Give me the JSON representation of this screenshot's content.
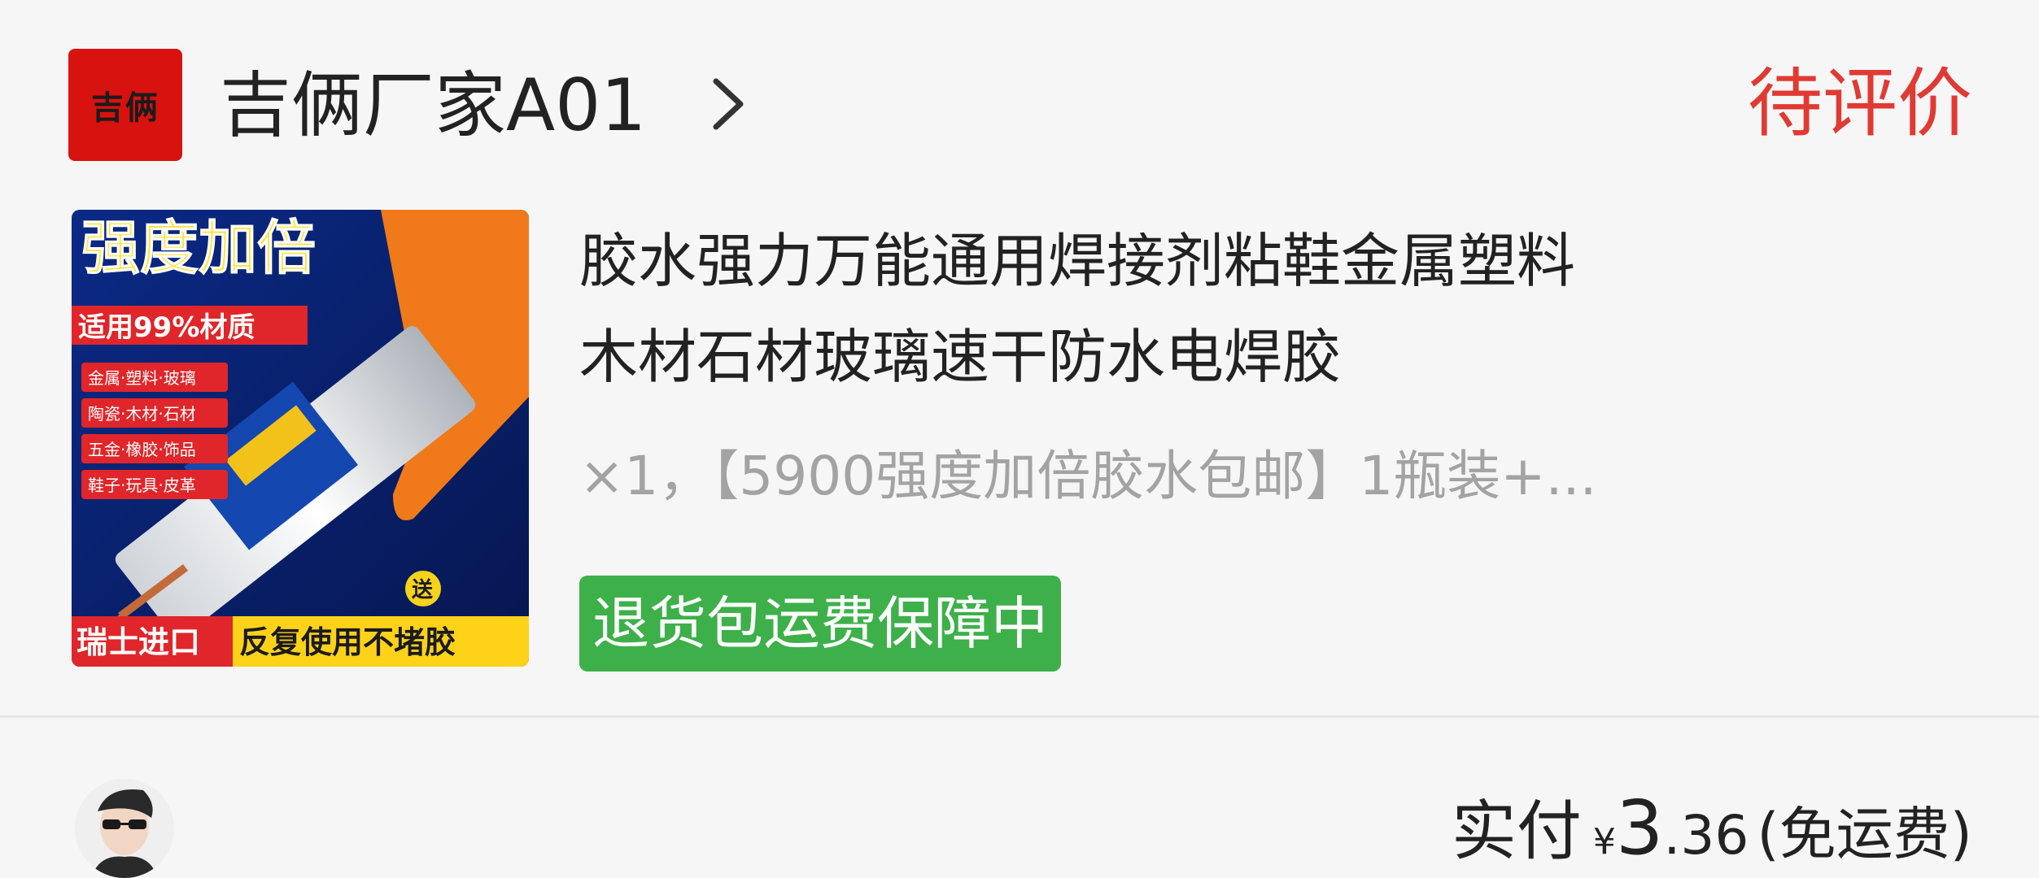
{
  "shop": {
    "logo_text": "吉俩",
    "name": "吉俩厂家A01",
    "chevron_icon": "chevron-right-icon"
  },
  "order": {
    "status": "待评价"
  },
  "product": {
    "image_texts": {
      "headline": "强度加倍",
      "sub": "适用99%材质",
      "rows": [
        "金属·塑料·玻璃",
        "陶瓷·木材·石材",
        "五金·橡胶·饰品",
        "鞋子·玩具·皮革"
      ],
      "gift": "送",
      "bottom_left": "瑞士进口",
      "bottom_right": "反复使用不堵胶"
    },
    "title_line1": "胶水强力万能通用焊接剂粘鞋金属塑料",
    "title_line2": "木材石材玻璃速干防水电焊胶",
    "spec": "×1，【5900强度加倍胶水包邮】1瓶装+...",
    "tag": "退货包运费保障中"
  },
  "payment": {
    "label": "实付",
    "currency": "¥",
    "amount_int": "3",
    "amount_dec": ".36",
    "shipping": "(免运费)"
  },
  "colors": {
    "status_red": "#e03a33",
    "tag_green": "#3db04a",
    "spec_gray": "#a3a3a3",
    "logo_red": "#d8120f"
  }
}
